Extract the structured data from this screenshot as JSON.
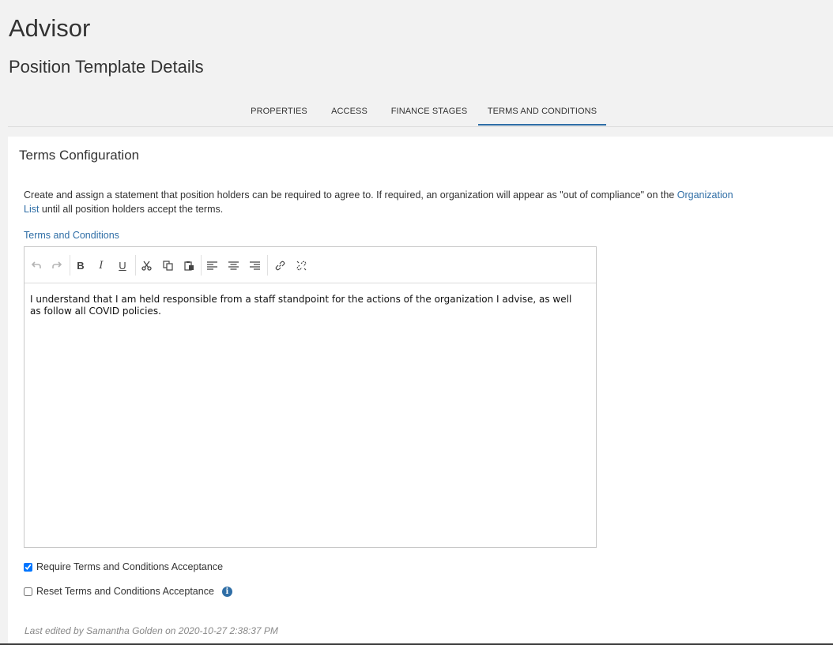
{
  "page": {
    "title": "Advisor",
    "subtitle": "Position Template Details"
  },
  "tabs": [
    {
      "label": "PROPERTIES",
      "active": false
    },
    {
      "label": "ACCESS",
      "active": false
    },
    {
      "label": "FINANCE STAGES",
      "active": false
    },
    {
      "label": "TERMS AND CONDITIONS",
      "active": true
    }
  ],
  "card": {
    "title": "Terms Configuration",
    "description_before_link": "Create and assign a statement that position holders can be required to agree to. If required, an organization will appear as \"out of compliance\" on the ",
    "description_link": "Organization List",
    "description_after_link": " until all position holders accept the terms.",
    "field_label": "Terms and Conditions",
    "editor_text": "I understand that I am held responsible from a staff standpoint for the actions of the organization I advise, as well as follow all COVID policies.",
    "toolbar": [
      {
        "icon": "undo-icon",
        "glyph": "↶",
        "enabled": false
      },
      {
        "icon": "redo-icon",
        "glyph": "↷",
        "enabled": false
      },
      {
        "icon": "bold-icon",
        "glyph": "B",
        "enabled": true
      },
      {
        "icon": "italic-icon",
        "glyph": "I",
        "enabled": true
      },
      {
        "icon": "underline-icon",
        "glyph": "U",
        "enabled": true
      },
      {
        "icon": "cut-icon",
        "glyph": "✂",
        "enabled": true
      },
      {
        "icon": "copy-icon",
        "glyph": "⧉",
        "enabled": true
      },
      {
        "icon": "paste-icon",
        "glyph": "📋",
        "enabled": true
      },
      {
        "icon": "align-left-icon",
        "glyph": "≡",
        "enabled": true
      },
      {
        "icon": "align-center-icon",
        "glyph": "≡",
        "enabled": true
      },
      {
        "icon": "align-right-icon",
        "glyph": "≡",
        "enabled": true
      },
      {
        "icon": "link-icon",
        "glyph": "🔗",
        "enabled": true
      },
      {
        "icon": "unlink-icon",
        "glyph": "⛓",
        "enabled": true
      }
    ],
    "require_acceptance": {
      "label": "Require Terms and Conditions Acceptance",
      "checked": true
    },
    "reset_acceptance": {
      "label": "Reset Terms and Conditions Acceptance",
      "checked": false
    },
    "info_glyph": "i",
    "last_edited": "Last edited by Samantha Golden on 2020-10-27 2:38:37 PM"
  },
  "colors": {
    "accent": "#2f6ea6",
    "background": "#f2f2f2",
    "card": "#ffffff"
  }
}
